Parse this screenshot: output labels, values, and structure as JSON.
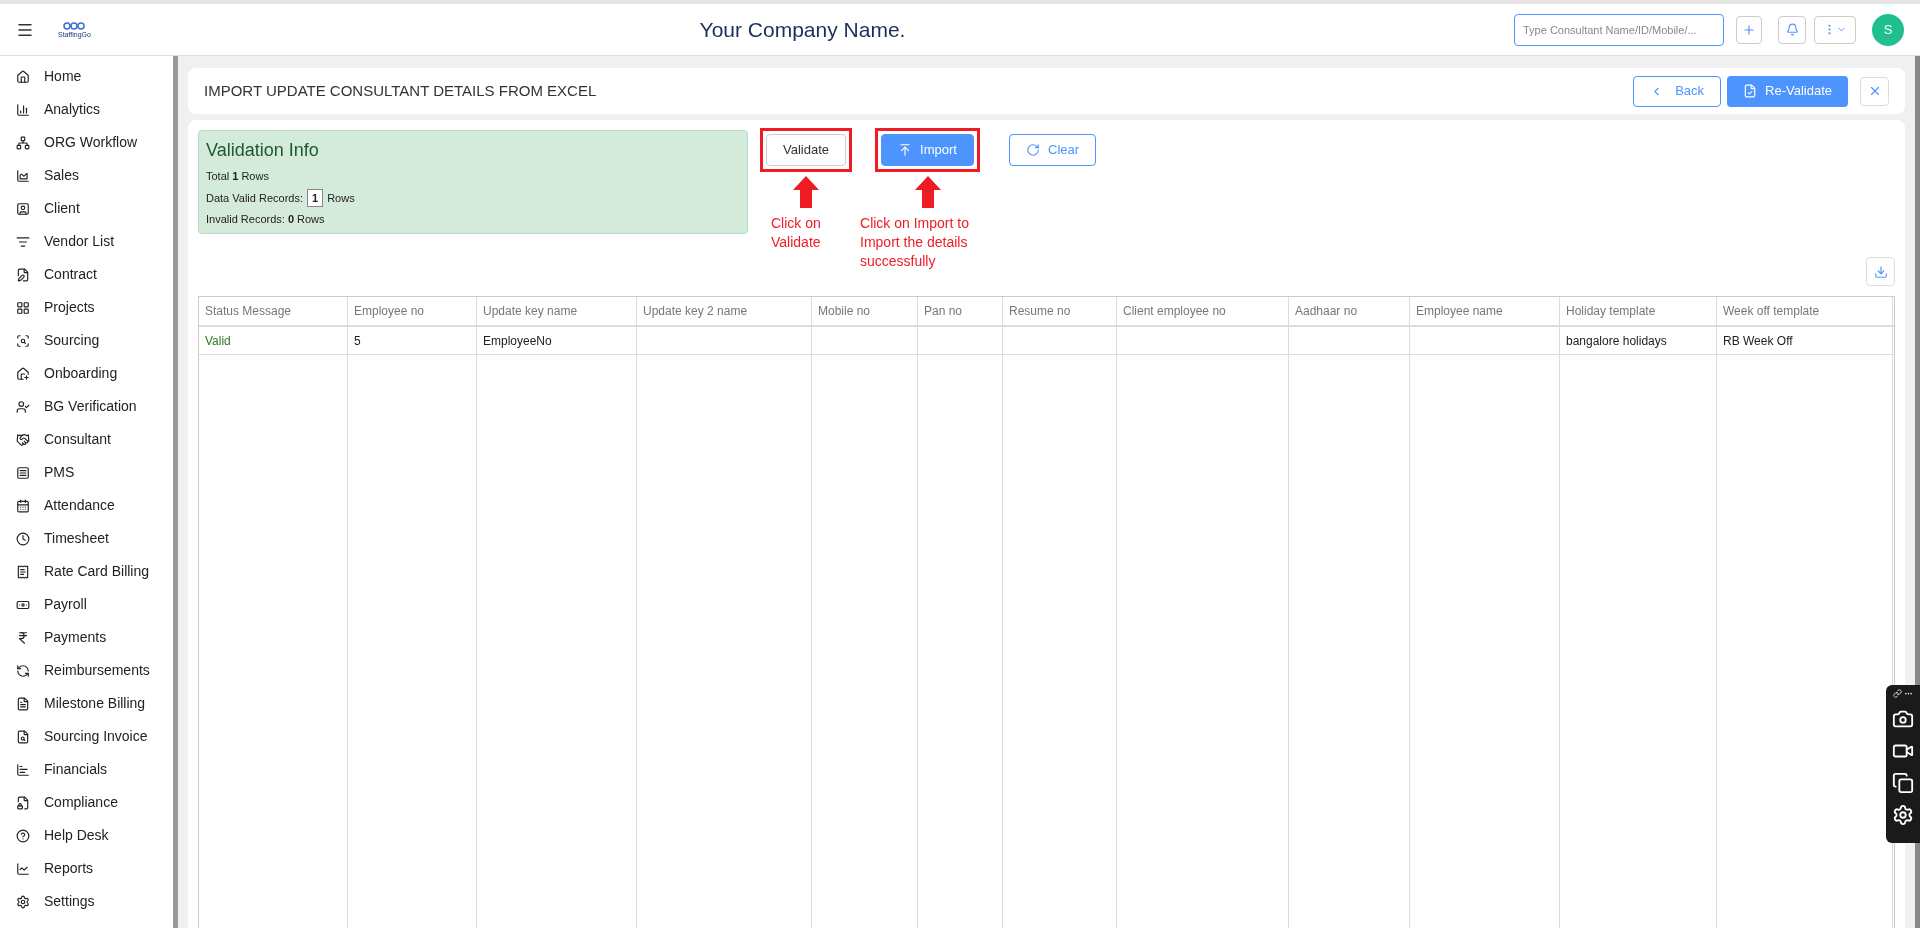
{
  "topbar": {
    "logo_text": "StaffingGo",
    "company": "Your Company Name.",
    "search": {
      "placeholder": "Type Consultant Name/ID/Mobile/..."
    },
    "avatar": "S"
  },
  "sidebar": {
    "items": [
      {
        "label": "Home"
      },
      {
        "label": "Analytics"
      },
      {
        "label": "ORG Workflow"
      },
      {
        "label": "Sales"
      },
      {
        "label": "Client"
      },
      {
        "label": "Vendor List"
      },
      {
        "label": "Contract"
      },
      {
        "label": "Projects"
      },
      {
        "label": "Sourcing"
      },
      {
        "label": "Onboarding"
      },
      {
        "label": "BG Verification"
      },
      {
        "label": "Consultant"
      },
      {
        "label": "PMS"
      },
      {
        "label": "Attendance"
      },
      {
        "label": "Timesheet"
      },
      {
        "label": "Rate Card Billing"
      },
      {
        "label": "Payroll"
      },
      {
        "label": "Payments"
      },
      {
        "label": "Reimbursements"
      },
      {
        "label": "Milestone Billing"
      },
      {
        "label": "Sourcing Invoice"
      },
      {
        "label": "Financials"
      },
      {
        "label": "Compliance"
      },
      {
        "label": "Help Desk"
      },
      {
        "label": "Reports"
      },
      {
        "label": "Settings"
      }
    ]
  },
  "header": {
    "title": "IMPORT UPDATE CONSULTANT DETAILS FROM EXCEL",
    "back": "Back",
    "revalidate": "Re-Validate"
  },
  "validation_info": {
    "title": "Validation Info",
    "lines": [
      [
        "Total ",
        "1",
        " Rows"
      ],
      [
        "Data Valid Records: ",
        "1",
        " Rows"
      ],
      [
        "Invalid Records: ",
        "0",
        " Rows"
      ]
    ]
  },
  "actions": [
    {
      "label": "Validate",
      "kind": "outline",
      "highlighted": true,
      "note": "Click on Validate"
    },
    {
      "label": "Import",
      "kind": "primary",
      "highlighted": true,
      "note": "Click on Import to Import the details successfully"
    },
    {
      "label": "Clear",
      "kind": "secondary",
      "highlighted": false
    }
  ],
  "table": {
    "columns": [
      "Status Message",
      "Employee no",
      "Update key name",
      "Update key 2 name",
      "Mobile no",
      "Pan no",
      "Resume no",
      "Client employee no",
      "Aadhaar no",
      "Employee name",
      "Holiday template",
      "Week off template"
    ],
    "rows": [
      {
        "valid": true,
        "cells": [
          "Valid",
          "5",
          "EmployeeNo",
          "",
          "",
          "",
          "",
          "",
          "",
          "",
          "bangalore holidays",
          "RB Week Off"
        ]
      }
    ]
  }
}
